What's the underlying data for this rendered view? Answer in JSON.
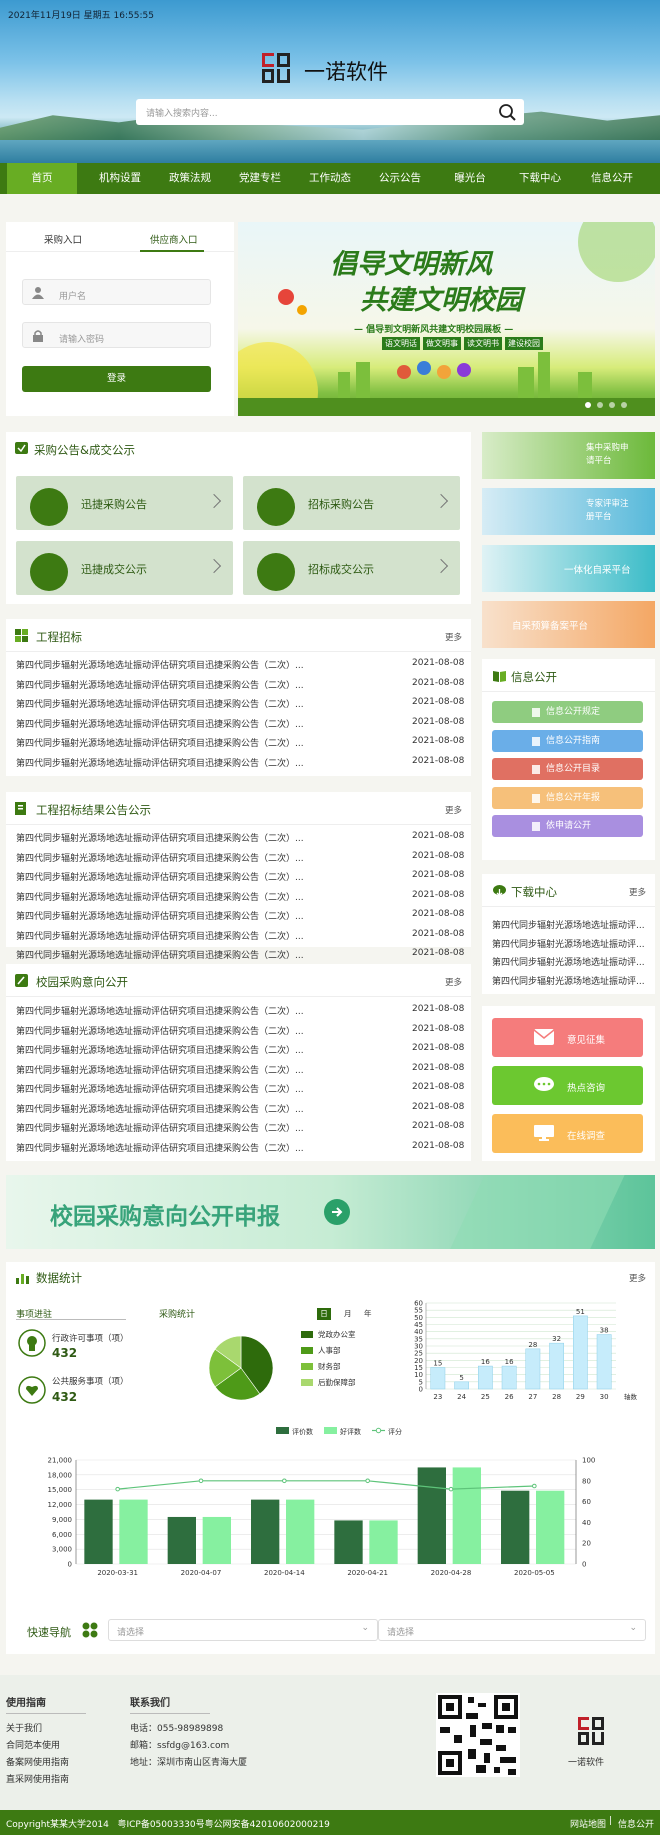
{
  "header": {
    "datetime": "2021年11月19日  星期五  16:55:55",
    "brand": "一诺软件",
    "search_placeholder": "请输入搜索内容..."
  },
  "nav": [
    "首页",
    "机构设置",
    "政策法规",
    "党建专栏",
    "工作动态",
    "公示公告",
    "曝光台",
    "下载中心",
    "信息公开"
  ],
  "login": {
    "tabs": [
      "采购入口",
      "供应商入口"
    ],
    "username_placeholder": "用户名",
    "password_placeholder": "请输入密码",
    "button": "登录"
  },
  "banner": {
    "line1": "倡导文明新风",
    "line2": "共建文明校园",
    "sub": "— 倡导到文明新风共建文明校园展板 —",
    "tags": [
      "语文明话",
      "做文明事",
      "读文明书",
      "建设校园"
    ]
  },
  "quick_platforms": [
    "集中采购申请平台",
    "专家评审注册平台",
    "一体化自采平台",
    "自采预算备案平台"
  ],
  "procurement": {
    "title": "采购公告&成交公示",
    "tiles": [
      "迅捷采购公告",
      "招标采购公告",
      "迅捷成交公示",
      "招标成交公示"
    ]
  },
  "lists": [
    {
      "title": "工程招标",
      "more": "更多",
      "rows": [
        "第四代同步辐射光源场地选址振动评估研究项目迅捷采购公告（二次）...",
        "第四代同步辐射光源场地选址振动评估研究项目迅捷采购公告（二次）...",
        "第四代同步辐射光源场地选址振动评估研究项目迅捷采购公告（二次）...",
        "第四代同步辐射光源场地选址振动评估研究项目迅捷采购公告（二次）...",
        "第四代同步辐射光源场地选址振动评估研究项目迅捷采购公告（二次）...",
        "第四代同步辐射光源场地选址振动评估研究项目迅捷采购公告（二次）..."
      ],
      "date": "2021-08-08"
    },
    {
      "title": "工程招标结果公告公示",
      "more": "更多",
      "rows": [
        "第四代同步辐射光源场地选址振动评估研究项目迅捷采购公告（二次）...",
        "第四代同步辐射光源场地选址振动评估研究项目迅捷采购公告（二次）...",
        "第四代同步辐射光源场地选址振动评估研究项目迅捷采购公告（二次）...",
        "第四代同步辐射光源场地选址振动评估研究项目迅捷采购公告（二次）...",
        "第四代同步辐射光源场地选址振动评估研究项目迅捷采购公告（二次）...",
        "第四代同步辐射光源场地选址振动评估研究项目迅捷采购公告（二次）...",
        "第四代同步辐射光源场地选址振动评估研究项目迅捷采购公告（二次）..."
      ],
      "date": "2021-08-08"
    },
    {
      "title": "校园采购意向公开",
      "more": "更多",
      "rows": [
        "第四代同步辐射光源场地选址振动评估研究项目迅捷采购公告（二次）...",
        "第四代同步辐射光源场地选址振动评估研究项目迅捷采购公告（二次）...",
        "第四代同步辐射光源场地选址振动评估研究项目迅捷采购公告（二次）...",
        "第四代同步辐射光源场地选址振动评估研究项目迅捷采购公告（二次）...",
        "第四代同步辐射光源场地选址振动评估研究项目迅捷采购公告（二次）...",
        "第四代同步辐射光源场地选址振动评估研究项目迅捷采购公告（二次）...",
        "第四代同步辐射光源场地选址振动评估研究项目迅捷采购公告（二次）...",
        "第四代同步辐射光源场地选址振动评估研究项目迅捷采购公告（二次）..."
      ],
      "date": "2021-08-08"
    }
  ],
  "info_public": {
    "title": "信息公开",
    "items": [
      "信息公开规定",
      "信息公开指南",
      "信息公开目录",
      "信息公开年报",
      "依申请公开"
    ],
    "colors": [
      "#8fcc80",
      "#6aaee8",
      "#e07062",
      "#f6c07a",
      "#a98fe0"
    ]
  },
  "download": {
    "title": "下载中心",
    "more": "更多",
    "rows": [
      "第四代同步辐射光源场地选址振动评...",
      "第四代同步辐射光源场地选址振动评...",
      "第四代同步辐射光源场地选址振动评...",
      "第四代同步辐射光源场地选址振动评..."
    ]
  },
  "actions": [
    "意见征集",
    "热点咨询",
    "在线调查"
  ],
  "campus_banner": "校园采购意向公开申报",
  "stats": {
    "title": "数据统计",
    "more": "更多",
    "progress_title": "事项进驻",
    "items": [
      {
        "label": "行政许可事项（项）",
        "value": "432"
      },
      {
        "label": "公共服务事项（项）",
        "value": "432"
      }
    ],
    "purchase_title": "采购统计",
    "period": [
      "日",
      "月",
      "年"
    ],
    "pie_legend": [
      "党政办公室",
      "人事部",
      "财务部",
      "后勤保障部"
    ]
  },
  "chart_data": [
    {
      "type": "pie",
      "labels": [
        "党政办公室",
        "人事部",
        "财务部",
        "后勤保障部"
      ],
      "values": [
        40,
        25,
        20,
        15
      ],
      "colors": [
        "#2e6b0c",
        "#4e9a18",
        "#7dc03a",
        "#a9d86e"
      ]
    },
    {
      "type": "bar",
      "categories": [
        "23",
        "24",
        "25",
        "26",
        "27",
        "28",
        "29",
        "30"
      ],
      "values": [
        15,
        5,
        16,
        16,
        28,
        32,
        51,
        38
      ],
      "xlabel": "轴数",
      "ylim": [
        0,
        60
      ],
      "yticks": [
        "0",
        "5",
        "10",
        "15",
        "20",
        "25",
        "30",
        "35",
        "40",
        "45",
        "50",
        "55",
        "60"
      ]
    },
    {
      "type": "bar",
      "categories": [
        "2020-03-31",
        "2020-04-07",
        "2020-04-14",
        "2020-04-21",
        "2020-04-28",
        "2020-05-05"
      ],
      "series": [
        {
          "name": "评价数",
          "values": [
            13000,
            9500,
            13000,
            8800,
            19500,
            14800
          ],
          "color": "#2e6e3e"
        },
        {
          "name": "好评数",
          "values": [
            13000,
            9500,
            13000,
            8800,
            19500,
            14800
          ],
          "color": "#86f0a0"
        },
        {
          "name": "评分",
          "type": "line",
          "values": [
            72,
            80,
            80,
            80,
            72,
            75
          ],
          "color": "#5ec47a"
        }
      ],
      "ylim": [
        0,
        21000
      ],
      "y2lim": [
        0,
        100
      ],
      "yticks": [
        "0",
        "3,000",
        "6,000",
        "9,000",
        "12,000",
        "15,000",
        "18,000",
        "21,000"
      ],
      "y2ticks": [
        "0",
        "20",
        "40",
        "60",
        "80",
        "100"
      ]
    }
  ],
  "quicknav": {
    "label": "快速导航",
    "select1": "请选择",
    "select2": "请选择"
  },
  "footer": {
    "guide_title": "使用指南",
    "guide": [
      "关于我们",
      "合同范本使用",
      "备案网使用指南",
      "直采网使用指南"
    ],
    "contact_title": "联系我们",
    "contact": [
      "电话：055-98989898",
      "邮箱：ssfdg@163.com",
      "地址：深圳市南山区青海大厦"
    ],
    "brand": "一诺软件",
    "copyright": "Copyright某某大学2014   粤ICP备05003330号粤公网安备42010602000219",
    "links": [
      "网站地图",
      "信息公开"
    ]
  }
}
